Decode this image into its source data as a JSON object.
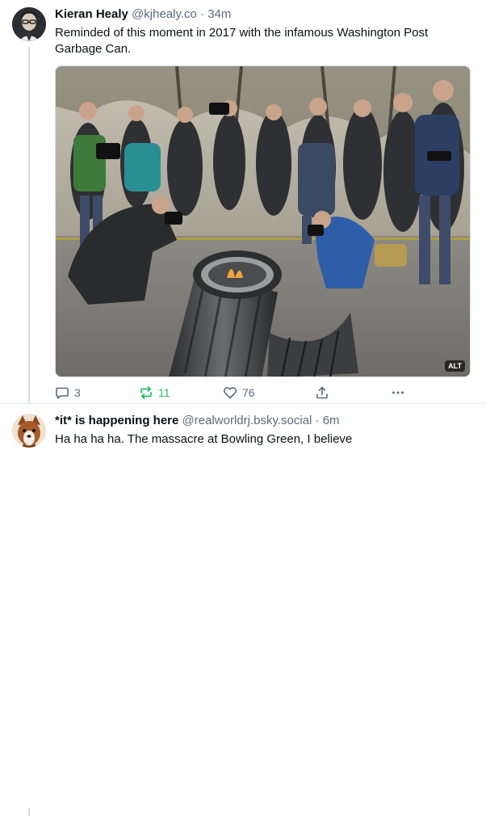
{
  "posts": [
    {
      "author_name": "Kieran Healy",
      "author_handle": "@kjhealy.co",
      "separator": "·",
      "time": "34m",
      "text": "Reminded of this moment in 2017 with the infamous Washington Post Garbage Can.",
      "image_alt_badge": "ALT",
      "reply_count": "3",
      "repost_count": "11",
      "like_count": "76",
      "reposted": true
    },
    {
      "author_name": "*it* is happening here",
      "author_handle": "@realworldrj.bsky.social",
      "separator": "·",
      "time": "6m",
      "text": "Ha ha ha ha. The massacre at Bowling Green, I believe"
    }
  ],
  "colors": {
    "text": "#0b0f14",
    "muted": "#5b6b7c",
    "repost_active": "#20bc5a",
    "thread_line": "#d6dde5"
  },
  "icons": [
    "reply-icon",
    "repost-icon",
    "like-icon",
    "share-icon",
    "more-icon"
  ]
}
